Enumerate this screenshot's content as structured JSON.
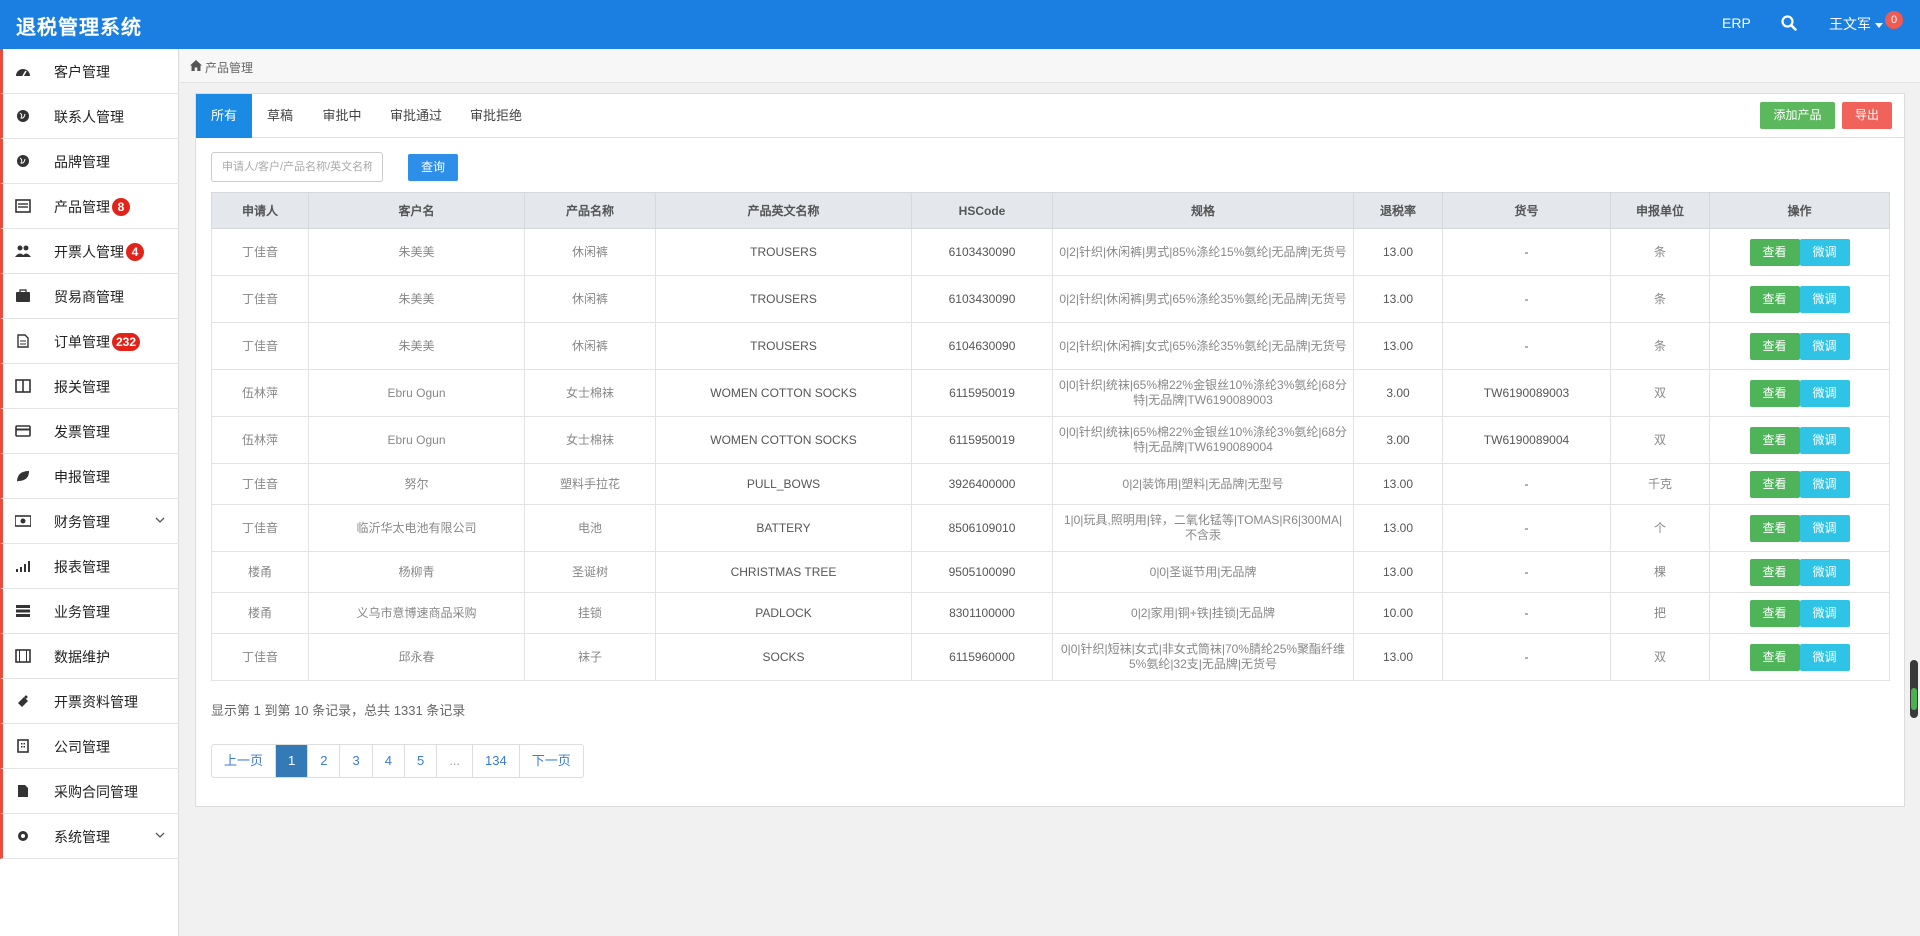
{
  "app": {
    "title": "退税管理系统"
  },
  "topbar": {
    "erp": "ERP",
    "user": "王文军",
    "notifications": "0"
  },
  "sidebar": {
    "items": [
      {
        "label": "客户管理",
        "icon": "dashboard-icon"
      },
      {
        "label": "联系人管理",
        "icon": "globe-icon"
      },
      {
        "label": "品牌管理",
        "icon": "globe-icon"
      },
      {
        "label": "产品管理",
        "icon": "list-icon",
        "badge": "8"
      },
      {
        "label": "开票人管理",
        "icon": "users-icon",
        "badge": "4"
      },
      {
        "label": "贸易商管理",
        "icon": "briefcase-icon"
      },
      {
        "label": "订单管理",
        "icon": "file-icon",
        "badge": "232"
      },
      {
        "label": "报关管理",
        "icon": "columns-icon"
      },
      {
        "label": "发票管理",
        "icon": "credit-card-icon"
      },
      {
        "label": "申报管理",
        "icon": "leaf-icon"
      },
      {
        "label": "财务管理",
        "icon": "money-icon",
        "chevron": true
      },
      {
        "label": "报表管理",
        "icon": "signal-icon"
      },
      {
        "label": "业务管理",
        "icon": "server-icon"
      },
      {
        "label": "数据维护",
        "icon": "film-icon"
      },
      {
        "label": "开票资料管理",
        "icon": "ticket-icon"
      },
      {
        "label": "公司管理",
        "icon": "building-icon"
      },
      {
        "label": "采购合同管理",
        "icon": "file-text-icon"
      },
      {
        "label": "系统管理",
        "icon": "cog-icon",
        "chevron": true
      }
    ]
  },
  "breadcrumb": {
    "icon": "home-icon",
    "text": "产品管理"
  },
  "tabs": [
    {
      "label": "所有",
      "active": true
    },
    {
      "label": "草稿"
    },
    {
      "label": "审批中"
    },
    {
      "label": "审批通过"
    },
    {
      "label": "审批拒绝"
    }
  ],
  "toolbar": {
    "add_label": "添加产品",
    "export_label": "导出"
  },
  "search": {
    "placeholder": "申请人/客户/产品名称/英文名称",
    "button": "查询"
  },
  "table": {
    "headers": [
      "申请人",
      "客户名",
      "产品名称",
      "产品英文名称",
      "HSCode",
      "规格",
      "退税率",
      "货号",
      "申报单位",
      "操作"
    ],
    "view_label": "查看",
    "tweak_label": "微调",
    "rows": [
      {
        "applicant": "丁佳音",
        "customer": "朱美美",
        "product": "休闲裤",
        "english": "TROUSERS",
        "hscode": "6103430090",
        "spec": "0|2|针织|休闲裤|男式|85%涤纶15%氨纶|无品牌|无货号",
        "rate": "13.00",
        "sku": "-",
        "unit": "条"
      },
      {
        "applicant": "丁佳音",
        "customer": "朱美美",
        "product": "休闲裤",
        "english": "TROUSERS",
        "hscode": "6103430090",
        "spec": "0|2|针织|休闲裤|男式|65%涤纶35%氨纶|无品牌|无货号",
        "rate": "13.00",
        "sku": "-",
        "unit": "条"
      },
      {
        "applicant": "丁佳音",
        "customer": "朱美美",
        "product": "休闲裤",
        "english": "TROUSERS",
        "hscode": "6104630090",
        "spec": "0|2|针织|休闲裤|女式|65%涤纶35%氨纶|无品牌|无货号",
        "rate": "13.00",
        "sku": "-",
        "unit": "条"
      },
      {
        "applicant": "伍林萍",
        "customer": "Ebru Ogun",
        "product": "女士棉袜",
        "english": "WOMEN COTTON SOCKS",
        "hscode": "6115950019",
        "spec": "0|0|针织|统袜|65%棉22%金银丝10%涤纶3%氨纶|68分特|无品牌|TW6190089003",
        "rate": "3.00",
        "sku": "TW6190089003",
        "unit": "双"
      },
      {
        "applicant": "伍林萍",
        "customer": "Ebru Ogun",
        "product": "女士棉袜",
        "english": "WOMEN COTTON SOCKS",
        "hscode": "6115950019",
        "spec": "0|0|针织|统袜|65%棉22%金银丝10%涤纶3%氨纶|68分特|无品牌|TW6190089004",
        "rate": "3.00",
        "sku": "TW6190089004",
        "unit": "双"
      },
      {
        "applicant": "丁佳音",
        "customer": "努尔",
        "product": "塑料手拉花",
        "english": "PULL_BOWS",
        "hscode": "3926400000",
        "spec": "0|2|装饰用|塑料|无品牌|无型号",
        "rate": "13.00",
        "sku": "-",
        "unit": "千克"
      },
      {
        "applicant": "丁佳音",
        "customer": "临沂华太电池有限公司",
        "product": "电池",
        "english": "BATTERY",
        "hscode": "8506109010",
        "spec": "1|0|玩具,照明用|锌，二氧化锰等|TOMAS|R6|300MA|不含汞",
        "rate": "13.00",
        "sku": "-",
        "unit": "个"
      },
      {
        "applicant": "楼甬",
        "customer": "杨柳青",
        "product": "圣诞树",
        "english": "CHRISTMAS TREE",
        "hscode": "9505100090",
        "spec": "0|0|圣诞节用|无品牌",
        "rate": "13.00",
        "sku": "-",
        "unit": "棵"
      },
      {
        "applicant": "楼甬",
        "customer": "义乌市意博速商品采购",
        "product": "挂锁",
        "english": "PADLOCK",
        "hscode": "8301100000",
        "spec": "0|2|家用|铜+铁|挂锁|无品牌",
        "rate": "10.00",
        "sku": "-",
        "unit": "把"
      },
      {
        "applicant": "丁佳音",
        "customer": "邱永春",
        "product": "袜子",
        "english": "SOCKS",
        "hscode": "6115960000",
        "spec": "0|0|针织|短袜|女式|非女式筒袜|70%腈纶25%聚酯纤维5%氨纶|32支|无品牌|无货号",
        "rate": "13.00",
        "sku": "-",
        "unit": "双"
      }
    ]
  },
  "summary": "显示第 1 到第 10 条记录，总共 1331 条记录",
  "pagination": {
    "prev": "上一页",
    "pages": [
      "1",
      "2",
      "3",
      "4",
      "5",
      "...",
      "134"
    ],
    "next": "下一页",
    "current": "1"
  }
}
